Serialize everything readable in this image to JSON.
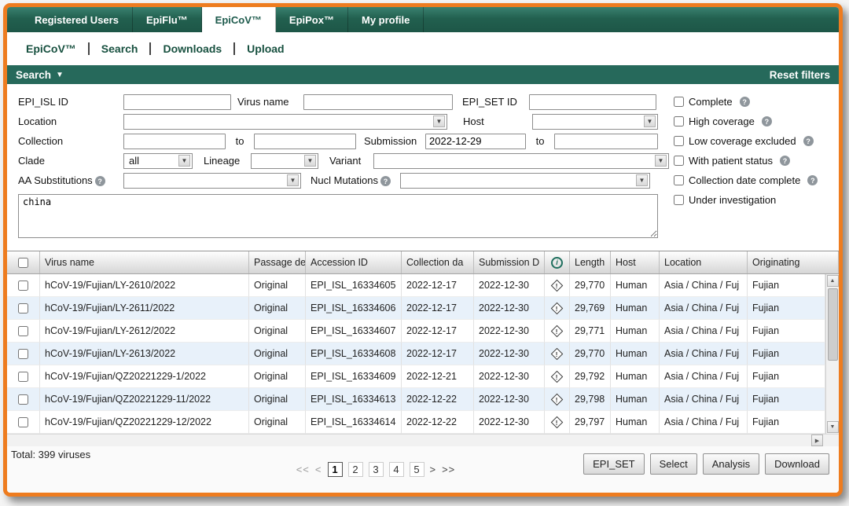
{
  "icons": {
    "dropdown": "▼",
    "collapse": "▼",
    "scroll_up": "▲",
    "scroll_down": "▼",
    "scroll_right": "▶",
    "help": "?",
    "info": "i",
    "warning": "!"
  },
  "colors": {
    "teal_dark": "#1d5647",
    "teal": "#26695b",
    "orange_border": "#ee7c1f",
    "row_alt": "#e8f1fa"
  },
  "topnav": {
    "tabs": [
      {
        "label": "Registered Users",
        "active": false
      },
      {
        "label": "EpiFlu™",
        "active": false
      },
      {
        "label": "EpiCoV™",
        "active": true
      },
      {
        "label": "EpiPox™",
        "active": false
      },
      {
        "label": "My profile",
        "active": false
      }
    ]
  },
  "subnav": {
    "items": [
      "EpiCoV™",
      "Search",
      "Downloads",
      "Upload"
    ]
  },
  "searchbar": {
    "title": "Search",
    "reset": "Reset filters"
  },
  "filters": {
    "epi_isl_id": {
      "label": "EPI_ISL ID",
      "value": ""
    },
    "virus_name": {
      "label": "Virus name",
      "value": ""
    },
    "epi_set_id": {
      "label": "EPI_SET ID",
      "value": ""
    },
    "location": {
      "label": "Location",
      "value": ""
    },
    "host": {
      "label": "Host",
      "value": ""
    },
    "collection": {
      "label": "Collection",
      "from": "",
      "to_label": "to",
      "to": ""
    },
    "submission": {
      "label": "Submission",
      "from": "2022-12-29",
      "to_label": "to",
      "to": ""
    },
    "clade": {
      "label": "Clade",
      "value": "all"
    },
    "lineage": {
      "label": "Lineage",
      "value": ""
    },
    "variant": {
      "label": "Variant",
      "value": ""
    },
    "aa_substitutions": {
      "label": "AA Substitutions",
      "value": ""
    },
    "nucl_mutations": {
      "label": "Nucl Mutations",
      "value": ""
    },
    "keyword": {
      "value": "china"
    },
    "checkboxes": [
      {
        "label": "Complete",
        "has_help": true
      },
      {
        "label": "High coverage",
        "has_help": true
      },
      {
        "label": "Low coverage excluded",
        "has_help": true
      },
      {
        "label": "With patient status",
        "has_help": true
      },
      {
        "label": "Collection date complete",
        "has_help": true
      },
      {
        "label": "Under investigation",
        "has_help": false
      }
    ]
  },
  "table": {
    "headers": {
      "virus_name": "Virus name",
      "passage": "Passage de",
      "accession": "Accession ID",
      "collection": "Collection da",
      "submission": "Submission D",
      "length": "Length",
      "host": "Host",
      "location": "Location",
      "originating": "Originating"
    },
    "rows": [
      {
        "virus_name": "hCoV-19/Fujian/LY-2610/2022",
        "passage": "Original",
        "accession_id": "EPI_ISL_16334605",
        "collection_date": "2022-12-17",
        "submission_date": "2022-12-30",
        "length": "29,770",
        "host": "Human",
        "location": "Asia / China / Fuj",
        "originating": "Fujian"
      },
      {
        "virus_name": "hCoV-19/Fujian/LY-2611/2022",
        "passage": "Original",
        "accession_id": "EPI_ISL_16334606",
        "collection_date": "2022-12-17",
        "submission_date": "2022-12-30",
        "length": "29,769",
        "host": "Human",
        "location": "Asia / China / Fuj",
        "originating": "Fujian"
      },
      {
        "virus_name": "hCoV-19/Fujian/LY-2612/2022",
        "passage": "Original",
        "accession_id": "EPI_ISL_16334607",
        "collection_date": "2022-12-17",
        "submission_date": "2022-12-30",
        "length": "29,771",
        "host": "Human",
        "location": "Asia / China / Fuj",
        "originating": "Fujian"
      },
      {
        "virus_name": "hCoV-19/Fujian/LY-2613/2022",
        "passage": "Original",
        "accession_id": "EPI_ISL_16334608",
        "collection_date": "2022-12-17",
        "submission_date": "2022-12-30",
        "length": "29,770",
        "host": "Human",
        "location": "Asia / China / Fuj",
        "originating": "Fujian"
      },
      {
        "virus_name": "hCoV-19/Fujian/QZ20221229-1/2022",
        "passage": "Original",
        "accession_id": "EPI_ISL_16334609",
        "collection_date": "2022-12-21",
        "submission_date": "2022-12-30",
        "length": "29,792",
        "host": "Human",
        "location": "Asia / China / Fuj",
        "originating": "Fujian"
      },
      {
        "virus_name": "hCoV-19/Fujian/QZ20221229-11/2022",
        "passage": "Original",
        "accession_id": "EPI_ISL_16334613",
        "collection_date": "2022-12-22",
        "submission_date": "2022-12-30",
        "length": "29,798",
        "host": "Human",
        "location": "Asia / China / Fuj",
        "originating": "Fujian"
      },
      {
        "virus_name": "hCoV-19/Fujian/QZ20221229-12/2022",
        "passage": "Original",
        "accession_id": "EPI_ISL_16334614",
        "collection_date": "2022-12-22",
        "submission_date": "2022-12-30",
        "length": "29,797",
        "host": "Human",
        "location": "Asia / China / Fuj",
        "originating": "Fujian"
      }
    ]
  },
  "footer": {
    "total": "Total: 399 viruses",
    "pagination": {
      "first": "<<",
      "prev": "<",
      "pages": [
        "1",
        "2",
        "3",
        "4",
        "5"
      ],
      "current_page": "1",
      "next": ">",
      "last": ">>"
    },
    "buttons": [
      "EPI_SET",
      "Select",
      "Analysis",
      "Download"
    ]
  }
}
